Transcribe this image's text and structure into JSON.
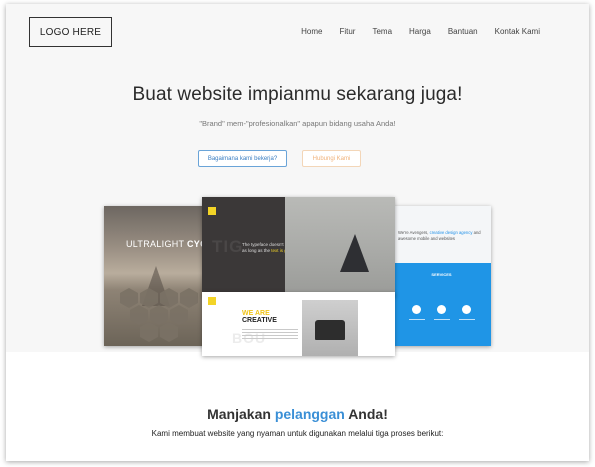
{
  "header": {
    "logo_text": "LOGO HERE",
    "nav": [
      "Home",
      "Fitur",
      "Tema",
      "Harga",
      "Bantuan",
      "Kontak Kami"
    ]
  },
  "hero": {
    "title": "Buat website impianmu sekarang juga!",
    "subtitle": "\"Brand\" mem-\"profesionalkan\" apapun bidang usaha Anda!",
    "primary_button": "Bagaimana kami bekerja?",
    "secondary_button": "Hubungi Kami"
  },
  "mockups": {
    "left_headline_light": "ULTRALIGHT ",
    "left_headline_bold": "CYC",
    "center_tagline_main": "The typeface doesn't really matter, as long as the ",
    "center_tagline_accent": "text is good",
    "center_ghost_text": "TIG",
    "bottom_we_are": "WE ARE",
    "bottom_creative": "CREATIVE",
    "bottom_ghost_text": "BOU",
    "right_text_main": "We're Avengers, ",
    "right_text_accent": "creative design agency",
    "right_text_tail": " and awesome mobile and websites",
    "right_services": "SERVICES"
  },
  "section": {
    "title_before": "Manjakan ",
    "title_accent": "pelanggan",
    "title_after": " Anda!",
    "subtitle": "Kami membuat website yang nyaman untuk digunakan melalui tiga proses berikut:"
  },
  "colors": {
    "accent_blue": "#3a8fd6",
    "button_primary_border": "#6aa4d8",
    "button_secondary_border": "#f3d6b8",
    "hero_background": "#f7f7f7"
  }
}
